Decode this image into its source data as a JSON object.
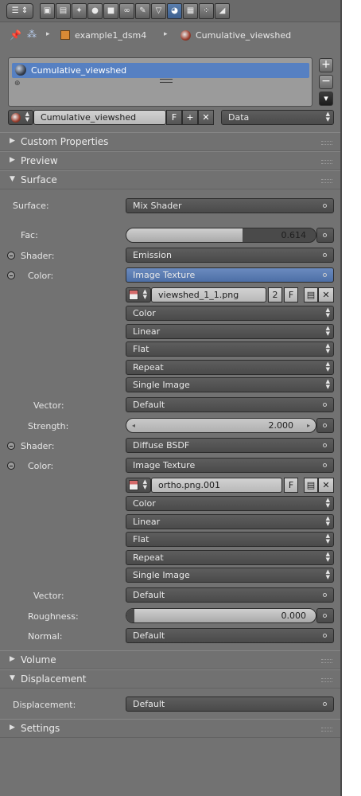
{
  "colors": {
    "panel_bg": "#727272",
    "selection": "#5680c2",
    "field_dark": "#4a4a4a",
    "field_light": "#c0c0c0"
  },
  "toolbar": {
    "editor_icon": "properties-editor-icon",
    "tabs": [
      {
        "icon": "render-icon",
        "glyph": "▣"
      },
      {
        "icon": "render-layers-icon",
        "glyph": "▤"
      },
      {
        "icon": "scene-icon",
        "glyph": "✦"
      },
      {
        "icon": "world-icon",
        "glyph": "●"
      },
      {
        "icon": "object-icon",
        "glyph": "■"
      },
      {
        "icon": "constraints-icon",
        "glyph": "∞"
      },
      {
        "icon": "modifiers-icon",
        "glyph": "✎"
      },
      {
        "icon": "object-data-icon",
        "glyph": "▽"
      },
      {
        "icon": "material-icon",
        "glyph": "◕"
      },
      {
        "icon": "texture-icon",
        "glyph": "▦"
      },
      {
        "icon": "particles-icon",
        "glyph": "⁘"
      },
      {
        "icon": "physics-icon",
        "glyph": "◢"
      }
    ]
  },
  "breadcrumb": {
    "object": "example1_dsm4",
    "material": "Cumulative_viewshed"
  },
  "slot_list": {
    "items": [
      "Cumulative_viewshed"
    ],
    "add": "+",
    "remove": "−",
    "menu": "▾"
  },
  "material_selector": {
    "name": "Cumulative_viewshed",
    "fake_user": "F",
    "new": "+",
    "unlink": "✕",
    "link_mode": "Data"
  },
  "panels": {
    "custom_properties": "Custom Properties",
    "preview": "Preview",
    "surface": "Surface",
    "volume": "Volume",
    "displacement": "Displacement",
    "settings": "Settings"
  },
  "surface": {
    "surface_label": "Surface:",
    "surface_value": "Mix Shader",
    "fac_label": "Fac:",
    "fac_value": "0.614",
    "fac_fraction": 0.614,
    "shader1_label": "Shader:",
    "shader1_value": "Emission",
    "color1_label": "Color:",
    "color1_value": "Image Texture",
    "image1": {
      "name": "viewshed_1_1.png",
      "users": "2",
      "fake": "F"
    },
    "image1_opts": [
      "Color",
      "Linear",
      "Flat",
      "Repeat",
      "Single Image"
    ],
    "vector1_label": "Vector:",
    "vector1_value": "Default",
    "strength_label": "Strength:",
    "strength_value": "2.000",
    "shader2_label": "Shader:",
    "shader2_value": "Diffuse BSDF",
    "color2_label": "Color:",
    "color2_value": "Image Texture",
    "image2": {
      "name": "ortho.png.001",
      "fake": "F"
    },
    "image2_opts": [
      "Color",
      "Linear",
      "Flat",
      "Repeat",
      "Single Image"
    ],
    "vector2_label": "Vector:",
    "vector2_value": "Default",
    "roughness_label": "Roughness:",
    "roughness_value": "0.000",
    "roughness_fraction": 0.0,
    "normal_label": "Normal:",
    "normal_value": "Default"
  },
  "displacement": {
    "label": "Displacement:",
    "value": "Default"
  }
}
